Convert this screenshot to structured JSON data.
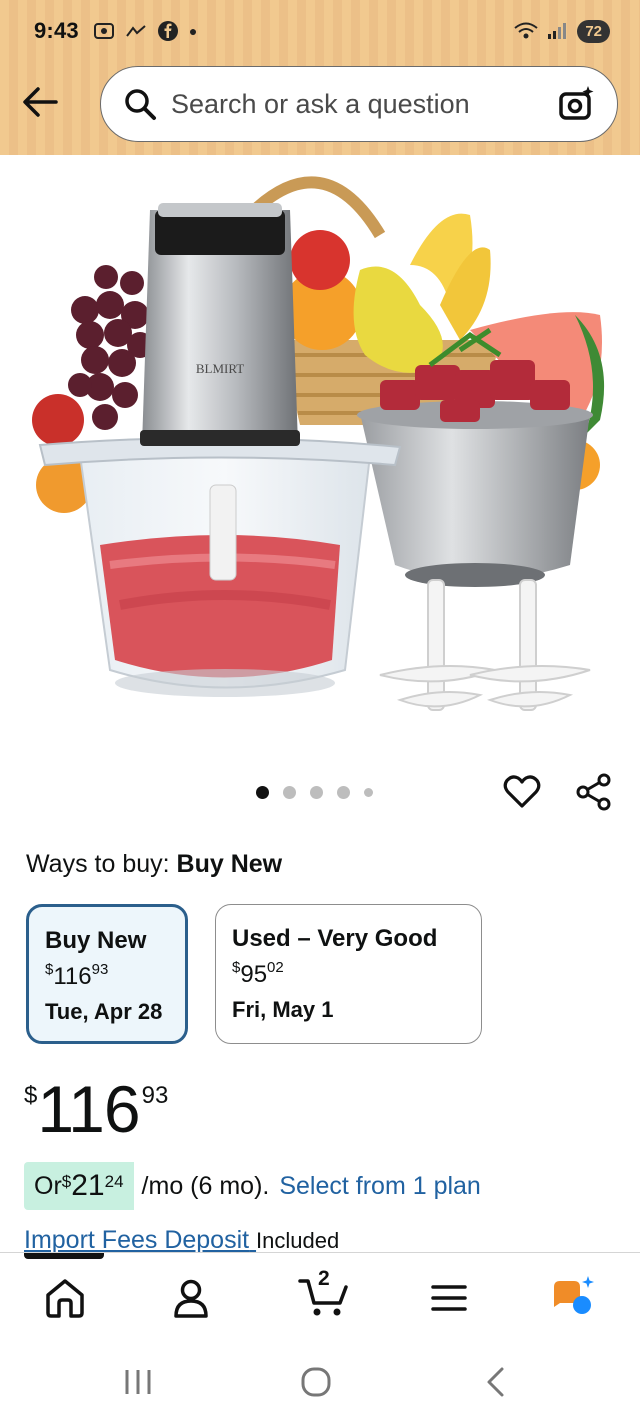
{
  "status_bar": {
    "time": "9:43",
    "battery": "72"
  },
  "search": {
    "placeholder": "Search or ask a question"
  },
  "carousel": {
    "image_brand_text": "BLMIRT",
    "total_images": 5,
    "active_index": 0
  },
  "ways_to_buy": {
    "label": "Ways to buy: ",
    "selected": "Buy New"
  },
  "options": [
    {
      "title": "Buy New",
      "currency": "$",
      "price_whole": "116",
      "price_fraction": "93",
      "date": "Tue, Apr 28",
      "selected": true
    },
    {
      "title": "Used – Very Good",
      "currency": "$",
      "price_whole": "95",
      "price_fraction": "02",
      "date": "Fri, May 1",
      "selected": false
    }
  ],
  "price": {
    "currency": "$",
    "whole": "116",
    "fraction": "93"
  },
  "monthly": {
    "prefix": "Or ",
    "currency": "$",
    "whole": "21",
    "fraction": "24",
    "suffix": "/mo (6 mo).",
    "link": "Select from 1 plan"
  },
  "import_fees": {
    "link": "Import Fees Deposit",
    "status": "Included"
  },
  "tabbar": {
    "cart_count": "2",
    "items": [
      "home-icon",
      "account-icon",
      "cart-icon",
      "menu-icon",
      "rufus-icon"
    ]
  },
  "colors": {
    "header_bg": "#f1c98f",
    "link": "#2162a1",
    "selected_border": "#2b5f8c",
    "installment_highlight": "#c8f0e0",
    "rufus_orange": "#f08c28",
    "rufus_blue": "#1a8cff"
  }
}
